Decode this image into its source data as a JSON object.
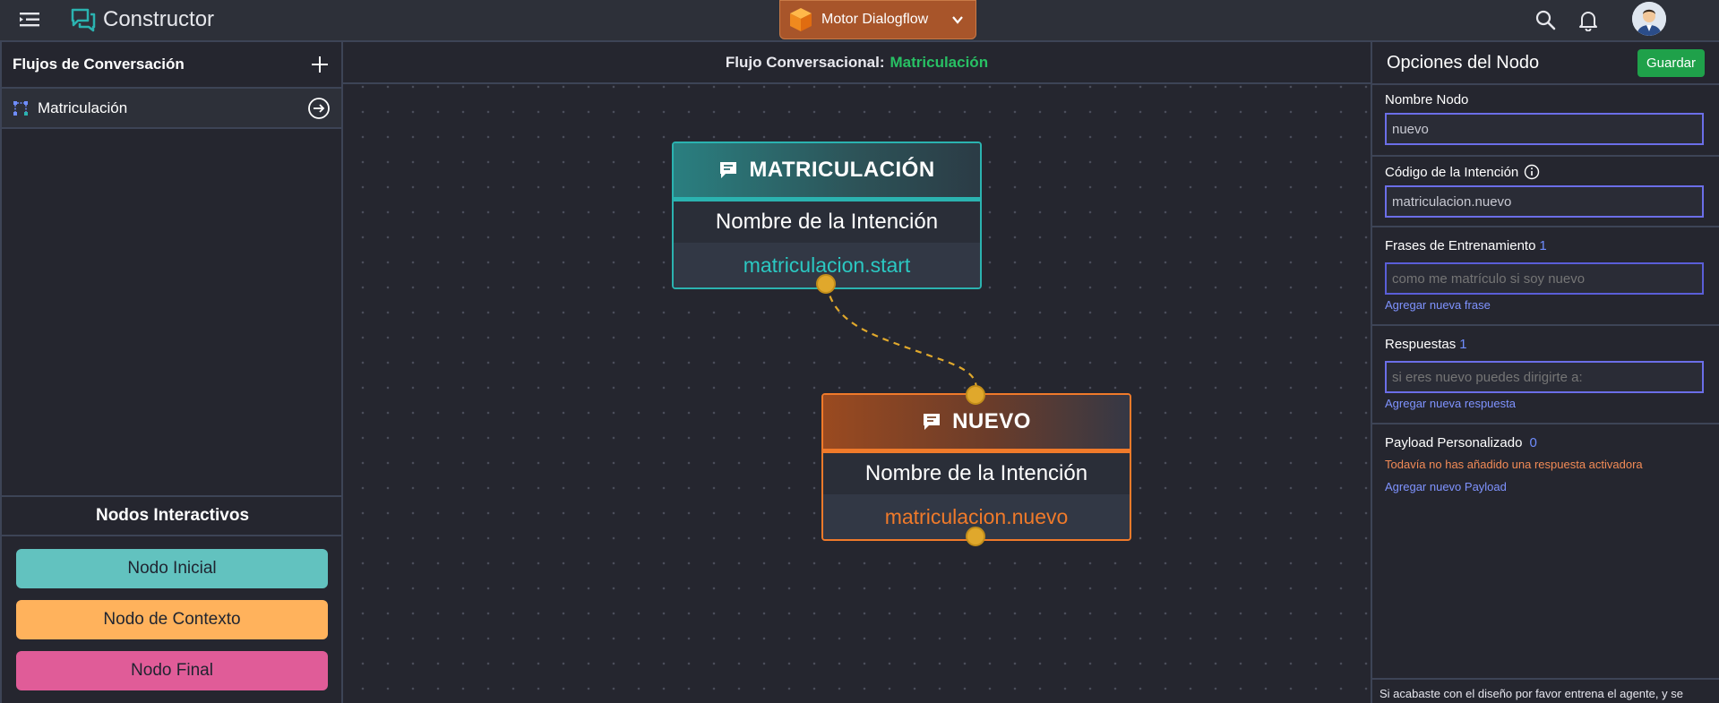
{
  "header": {
    "app_title": "Constructor",
    "engine_label": "Motor Dialogflow",
    "icons": [
      "menu-icon",
      "chat-logo-icon",
      "search-icon",
      "bell-icon",
      "avatar"
    ],
    "engine_color": "#a8552a"
  },
  "sidebar": {
    "title": "Flujos de Conversación",
    "flows": [
      {
        "label": "Matriculación"
      }
    ],
    "nodes_title": "Nodos Interactivos",
    "node_buttons": [
      {
        "label": "Nodo Inicial",
        "color": "#62c2bf"
      },
      {
        "label": "Nodo de Contexto",
        "color": "#ffb25c"
      },
      {
        "label": "Nodo Final",
        "color": "#e05c98"
      }
    ]
  },
  "canvas": {
    "title_prefix": "Flujo Conversacional:",
    "title_flow": "Matriculación",
    "nodes": [
      {
        "title": "MATRICULACIÓN",
        "row_label": "Nombre de la Intención",
        "intent": "matriculacion.start",
        "accent": "#2bb3b0"
      },
      {
        "title": "NUEVO",
        "row_label": "Nombre de la Intención",
        "intent": "matriculacion.nuevo",
        "accent": "#f07a2a"
      }
    ],
    "connector_color": "#e0a82c"
  },
  "options": {
    "title": "Opciones del Nodo",
    "save_label": "Guardar",
    "node_name_label": "Nombre Nodo",
    "node_name_value": "nuevo",
    "intent_code_label": "Código de la Intención",
    "intent_code_value": "matriculacion.nuevo",
    "training_label": "Frases de Entrenamiento",
    "training_count": "1",
    "training_placeholder": "como me matrículo si soy nuevo",
    "training_link": "Agregar nueva frase",
    "responses_label": "Respuestas",
    "responses_count": "1",
    "responses_placeholder": "si eres nuevo puedes dirigirte a:",
    "responses_link": "Agregar nueva respuesta",
    "payload_label": "Payload Personalizado",
    "payload_count": "0",
    "payload_warning": "Todavía no has añadido una respuesta activadora",
    "payload_link": "Agregar nuevo Payload",
    "footer_text": "Si acabaste con el diseño por favor entrena el agente, y se"
  }
}
